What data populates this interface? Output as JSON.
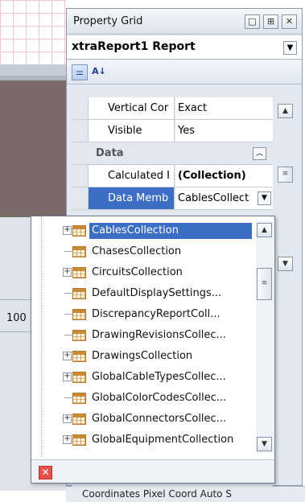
{
  "background": {
    "zoom_value": "100",
    "statusbar_text": "Coordinates   Pixel Coord   Auto S"
  },
  "property_grid": {
    "title": "Property Grid",
    "title_buttons": [
      "□",
      "⊞",
      "✕"
    ],
    "selected_object": "xtraReport1  Report",
    "toolbar": {
      "categorized_label": "⚌",
      "alphabetical_label": "A↓"
    },
    "rows": [
      {
        "name": "Vertical Cor",
        "value": "Exact"
      },
      {
        "name": "Visible",
        "value": "Yes"
      }
    ],
    "category": {
      "label": "Data",
      "toggle": "︿"
    },
    "data_rows": [
      {
        "name": "Calculated I",
        "value": "(Collection)"
      },
      {
        "name": "Data Memb",
        "value": "CablesCollect"
      }
    ]
  },
  "dropdown": {
    "items": [
      {
        "label": "CablesCollection",
        "expandable": true,
        "selected": true
      },
      {
        "label": "ChasesCollection",
        "expandable": false,
        "selected": false
      },
      {
        "label": "CircuitsCollection",
        "expandable": true,
        "selected": false
      },
      {
        "label": "DefaultDisplaySettings...",
        "expandable": false,
        "selected": false
      },
      {
        "label": "DiscrepancyReportColl...",
        "expandable": false,
        "selected": false
      },
      {
        "label": "DrawingRevisionsCollec...",
        "expandable": false,
        "selected": false
      },
      {
        "label": "DrawingsCollection",
        "expandable": true,
        "selected": false
      },
      {
        "label": "GlobalCableTypesCollec...",
        "expandable": true,
        "selected": false
      },
      {
        "label": "GlobalColorCodesCollec...",
        "expandable": false,
        "selected": false
      },
      {
        "label": "GlobalConnectorsCollec...",
        "expandable": true,
        "selected": false
      },
      {
        "label": "GlobalEquipmentCollection",
        "expandable": true,
        "selected": false
      }
    ],
    "close_label": "✕"
  }
}
